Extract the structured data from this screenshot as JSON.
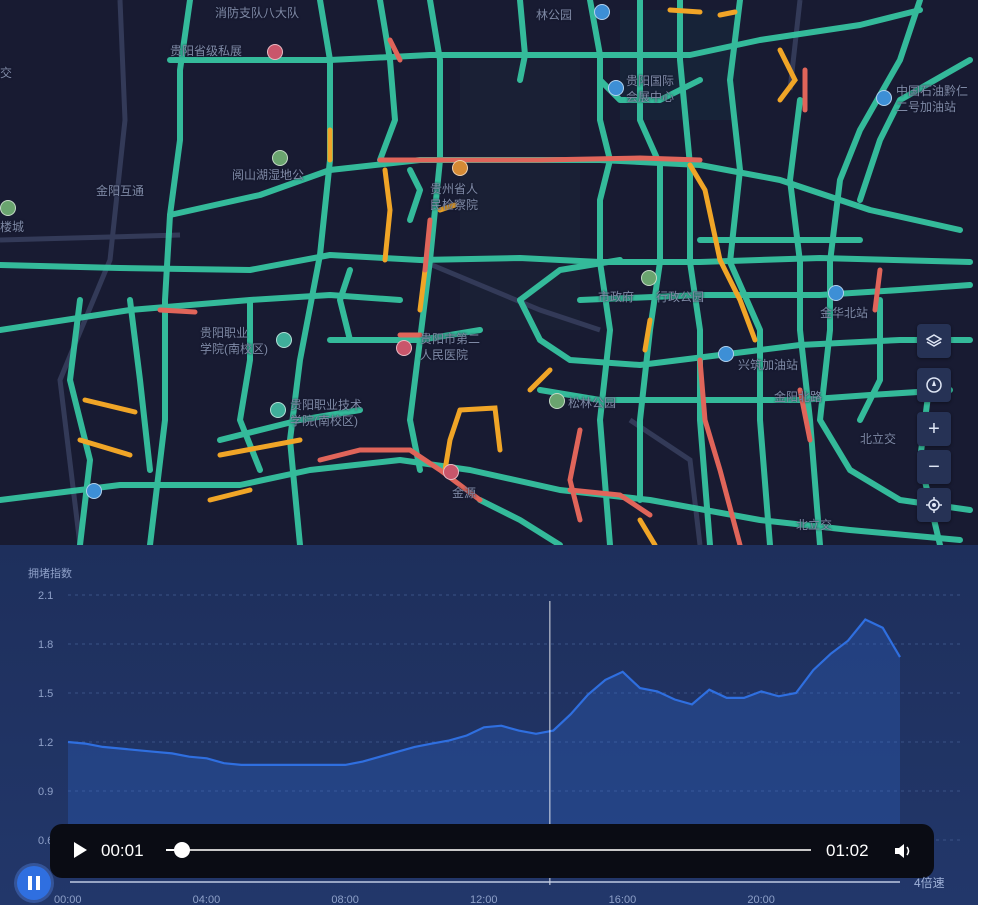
{
  "colors": {
    "road_free": "#36c3a0",
    "road_slow": "#f0a527",
    "road_jam": "#e0655a",
    "chart_line": "#2f6fe0",
    "panel_bg": "#1f3262"
  },
  "map": {
    "labels": [
      {
        "id": "l1",
        "text": "消防支队八大队"
      },
      {
        "id": "l2",
        "text": "林公园"
      },
      {
        "id": "l3",
        "text": "贵阳省级私展"
      },
      {
        "id": "l4",
        "text": "中国石油黔仁"
      },
      {
        "id": "l5",
        "text": "二号加油站"
      },
      {
        "id": "l6",
        "text": "贵阳国际"
      },
      {
        "id": "l7",
        "text": "会展中心"
      },
      {
        "id": "l8",
        "text": "金阳互通"
      },
      {
        "id": "l9",
        "text": "阅山湖湿地公"
      },
      {
        "id": "l10",
        "text": "贵州省人"
      },
      {
        "id": "l11",
        "text": "民检察院"
      },
      {
        "id": "l12",
        "text": "市政府"
      },
      {
        "id": "l13",
        "text": "行政公园"
      },
      {
        "id": "l14",
        "text": "贵阳职业"
      },
      {
        "id": "l15",
        "text": "学院(南校区)"
      },
      {
        "id": "l16",
        "text": "贵阳市第二"
      },
      {
        "id": "l17",
        "text": "人民医院"
      },
      {
        "id": "l18",
        "text": "兴筑加油站"
      },
      {
        "id": "l19",
        "text": "贵阳职业技术"
      },
      {
        "id": "l20",
        "text": "学院(南校区)"
      },
      {
        "id": "l21",
        "text": "松林公园"
      },
      {
        "id": "l22",
        "text": "金源"
      },
      {
        "id": "l23",
        "text": "金华北站"
      },
      {
        "id": "l24",
        "text": "北立交"
      },
      {
        "id": "l25",
        "text": "北立交"
      },
      {
        "id": "l26",
        "text": "交"
      },
      {
        "id": "l27",
        "text": "楼城"
      },
      {
        "id": "l28",
        "text": "金阳北路"
      }
    ],
    "controls": {
      "zoom_in": "+",
      "zoom_out": "−"
    }
  },
  "chart_data": {
    "type": "line",
    "title": "拥堵指数",
    "ylim": [
      0.6,
      2.1
    ],
    "yticks": [
      "2.1",
      "1.8",
      "1.5",
      "1.2",
      "0.9",
      "0.6"
    ],
    "xticks": [
      "00:00",
      "04:00",
      "08:00",
      "12:00",
      "16:00",
      "20:00"
    ],
    "x": [
      0,
      0.5,
      1,
      1.5,
      2,
      2.5,
      3,
      3.5,
      4,
      4.5,
      5,
      5.5,
      6,
      6.5,
      7,
      7.5,
      8,
      8.5,
      9,
      9.5,
      10,
      10.5,
      11,
      11.5,
      12,
      12.5,
      13,
      13.5,
      14,
      14.5,
      15,
      15.5,
      16,
      16.5,
      17,
      17.5,
      18,
      18.5,
      19,
      19.5,
      20,
      20.5,
      21,
      21.5,
      22,
      22.5,
      23,
      23.5,
      24
    ],
    "series": [
      {
        "values": [
          1.2,
          1.19,
          1.17,
          1.16,
          1.15,
          1.14,
          1.13,
          1.11,
          1.1,
          1.07,
          1.06,
          1.06,
          1.06,
          1.06,
          1.06,
          1.06,
          1.06,
          1.08,
          1.11,
          1.14,
          1.17,
          1.19,
          1.21,
          1.24,
          1.29,
          1.3,
          1.27,
          1.25,
          1.27,
          1.37,
          1.49,
          1.58,
          1.63,
          1.53,
          1.51,
          1.46,
          1.43,
          1.52,
          1.47,
          1.47,
          1.51,
          1.48,
          1.5,
          1.64,
          1.74,
          1.82,
          1.95,
          1.9,
          1.72
        ]
      }
    ],
    "cursor_x": 13.9
  },
  "video": {
    "current_time": "00:01",
    "duration": "01:02",
    "progress": 0.016
  },
  "speed_label": "4倍速"
}
